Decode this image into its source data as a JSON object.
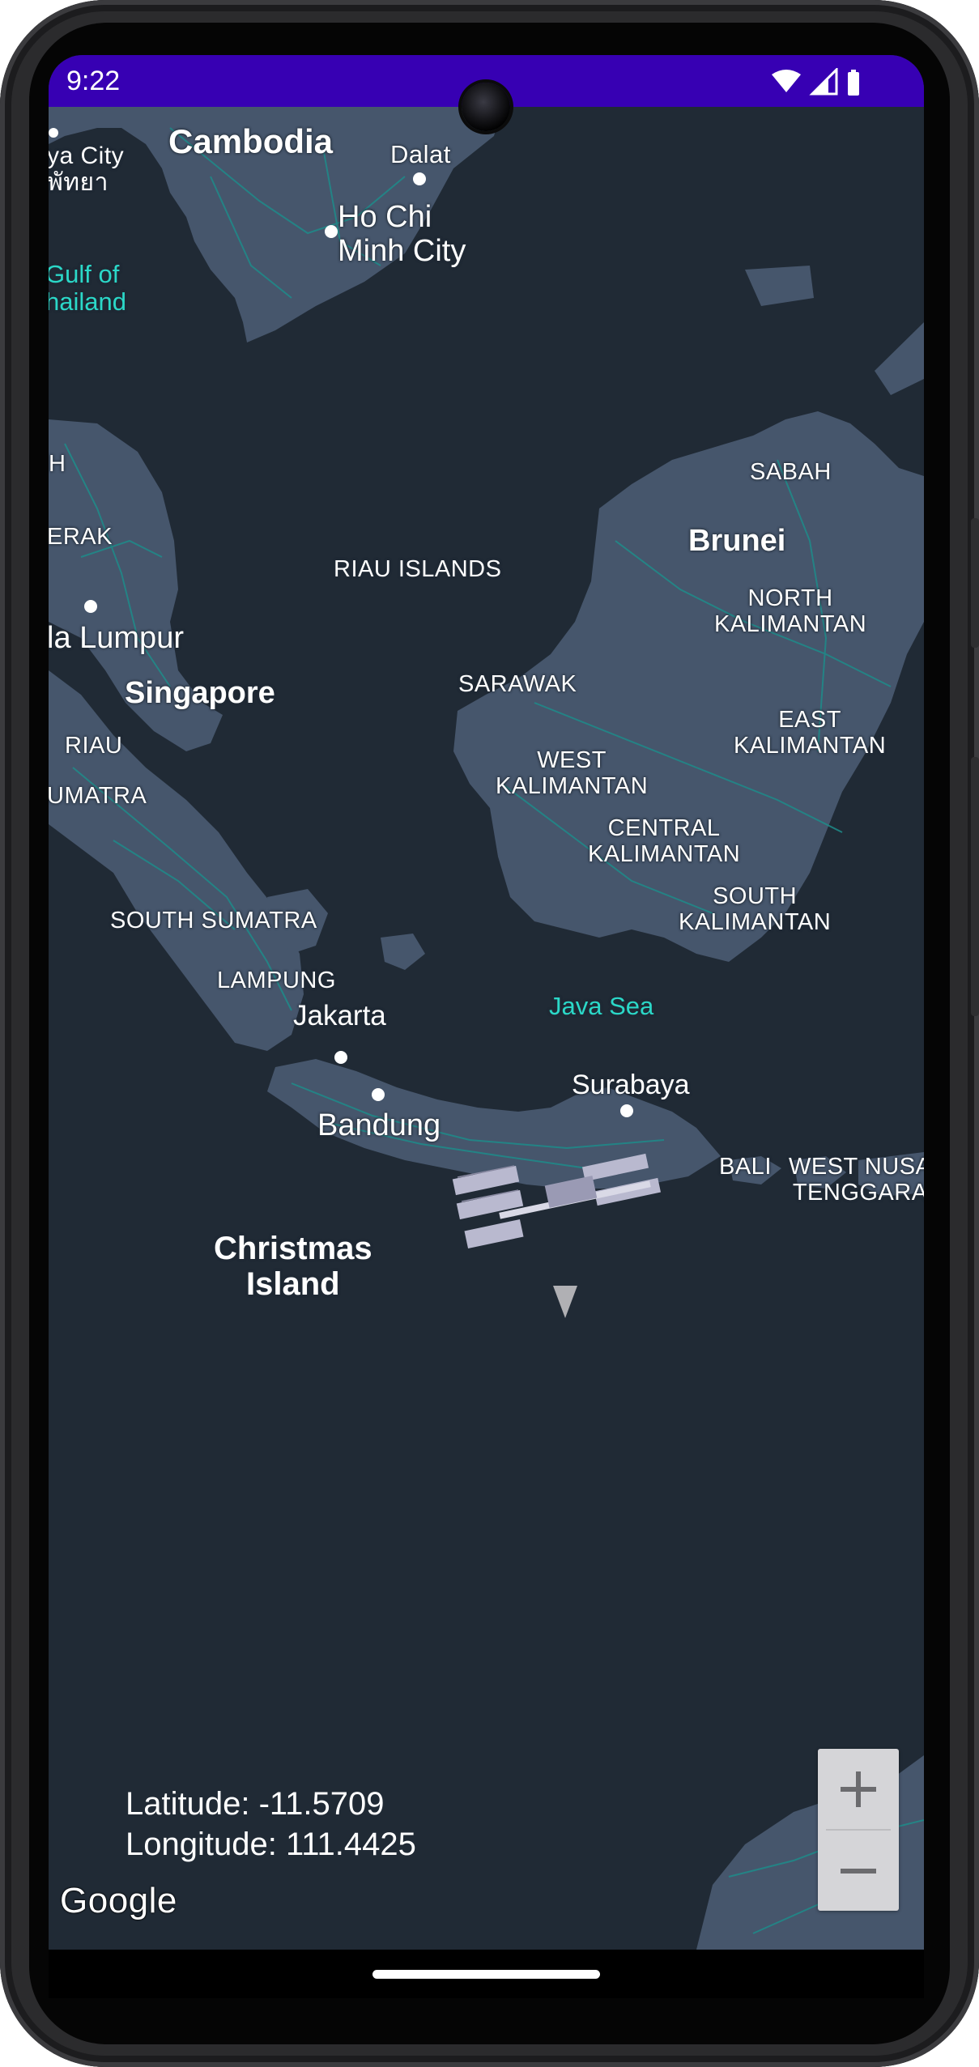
{
  "status_bar": {
    "time": "9:22",
    "icons": [
      "wifi-icon",
      "cell-signal-icon",
      "battery-icon"
    ],
    "color": "#3700b3"
  },
  "map": {
    "background_color": "#202a35",
    "land_color": "#46566c",
    "road_color": "#1e8c8a",
    "labels": {
      "cambodia": "Cambodia",
      "dalat": "Dalat",
      "ho_chi_minh": [
        "Ho Chi",
        "Minh City"
      ],
      "pattaya": [
        "ya City",
        "พัทยา"
      ],
      "gulf_of_thailand": [
        "Gulf of",
        "hailand"
      ],
      "sabah": "SABAH",
      "brunei": "Brunei",
      "north_kalimantan": [
        "NORTH",
        "KALIMANTAN"
      ],
      "east_kalimantan": [
        "EAST",
        "KALIMANTAN"
      ],
      "west_kalimantan": [
        "WEST",
        "KALIMANTAN"
      ],
      "central_kalimantan": [
        "CENTRAL",
        "KALIMANTAN"
      ],
      "south_kalimantan": [
        "SOUTH",
        "KALIMANTAN"
      ],
      "sarawak": "SARAWAK",
      "riau_islands": "RIAU ISLANDS",
      "h_partial": "H",
      "perak_partial": "ERAK",
      "kuala_lumpur": "la Lumpur",
      "singapore": "Singapore",
      "riau": "RIAU",
      "sumatra_partial": "UMATRA",
      "south_sumatra": "SOUTH SUMATRA",
      "lampung": "LAMPUNG",
      "jakarta": "Jakarta",
      "bandung": "Bandung",
      "surabaya": "Surabaya",
      "java_sea": "Java Sea",
      "bali": "BALI",
      "west_nusa_tenggara": [
        "WEST NUSA",
        "TENGGARA"
      ],
      "christmas_island": [
        "Christmas",
        "Island"
      ]
    },
    "marker": "iss-satellite-icon"
  },
  "position": {
    "latitude_text": "Latitude: -11.5709",
    "longitude_text": "Longitude: 111.4425"
  },
  "attribution": {
    "logo_text": "Google"
  },
  "zoom_controls": {
    "zoom_in": "+",
    "zoom_out": "−"
  }
}
